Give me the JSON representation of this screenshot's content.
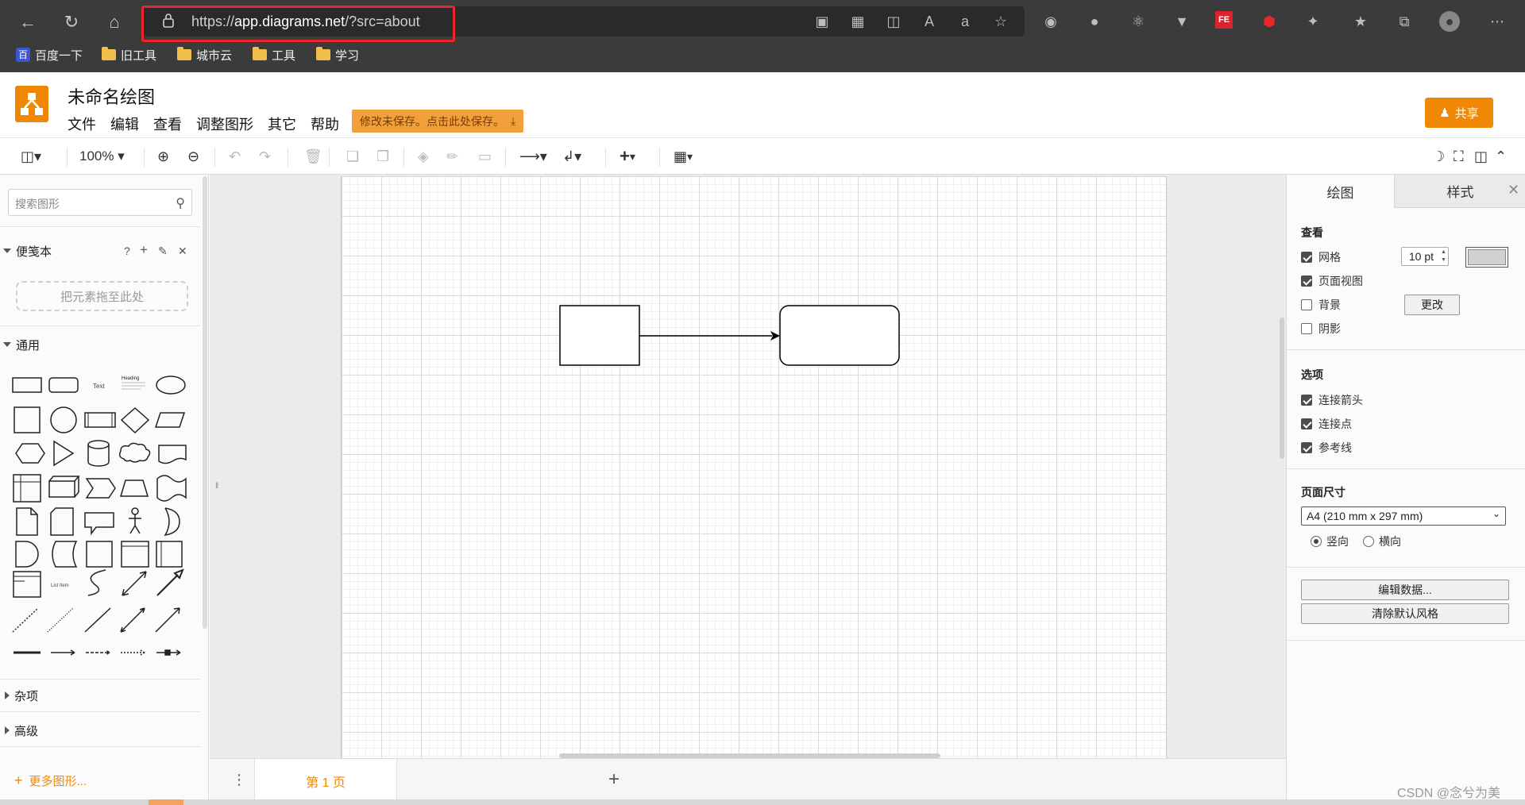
{
  "browser": {
    "url_prefix": "https://",
    "url_domain": "app.diagrams.net",
    "url_path": "/?src=about",
    "bookmarks": [
      "百度一下",
      "旧工具",
      "城市云",
      "工具",
      "学习"
    ],
    "baidu_glyph": "百"
  },
  "app": {
    "title": "未命名绘图",
    "menu": [
      "文件",
      "编辑",
      "查看",
      "调整图形",
      "其它",
      "帮助"
    ],
    "unsaved_notice": "修改未保存。点击此处保存。",
    "share_label": "共享",
    "accent_color": "#f08705"
  },
  "toolbar": {
    "zoom": "100%"
  },
  "sidebar": {
    "search_placeholder": "搜索图形",
    "scratchpad_title": "便笺本",
    "scratchpad_help": "?",
    "drop_zone": "把元素拖至此处",
    "general_title": "通用",
    "misc_title": "杂项",
    "advanced_title": "高级",
    "more_shapes": "更多图形...",
    "shape_text": "Text",
    "shape_heading": "Heading",
    "shape_list_item": "List Item"
  },
  "pages": {
    "tabs": [
      "第 1 页"
    ]
  },
  "format_panel": {
    "tabs": [
      "绘图",
      "样式"
    ],
    "view_title": "查看",
    "grid_label": "网格",
    "grid_checked": true,
    "grid_size": "10 pt",
    "page_view_label": "页面视图",
    "page_view_checked": true,
    "background_label": "背景",
    "background_checked": false,
    "change_button": "更改",
    "shadow_label": "阴影",
    "shadow_checked": false,
    "options_title": "选项",
    "connection_arrows_label": "连接箭头",
    "connection_arrows_checked": true,
    "connection_points_label": "连接点",
    "connection_points_checked": true,
    "guides_label": "参考线",
    "guides_checked": true,
    "paper_size_title": "页面尺寸",
    "paper_size_value": "A4 (210 mm x 297 mm)",
    "portrait_label": "竖向",
    "portrait_selected": true,
    "landscape_label": "横向",
    "landscape_selected": false,
    "edit_data_button": "编辑数据...",
    "clear_style_button": "清除默认风格"
  },
  "watermark": "CSDN @念兮为美"
}
